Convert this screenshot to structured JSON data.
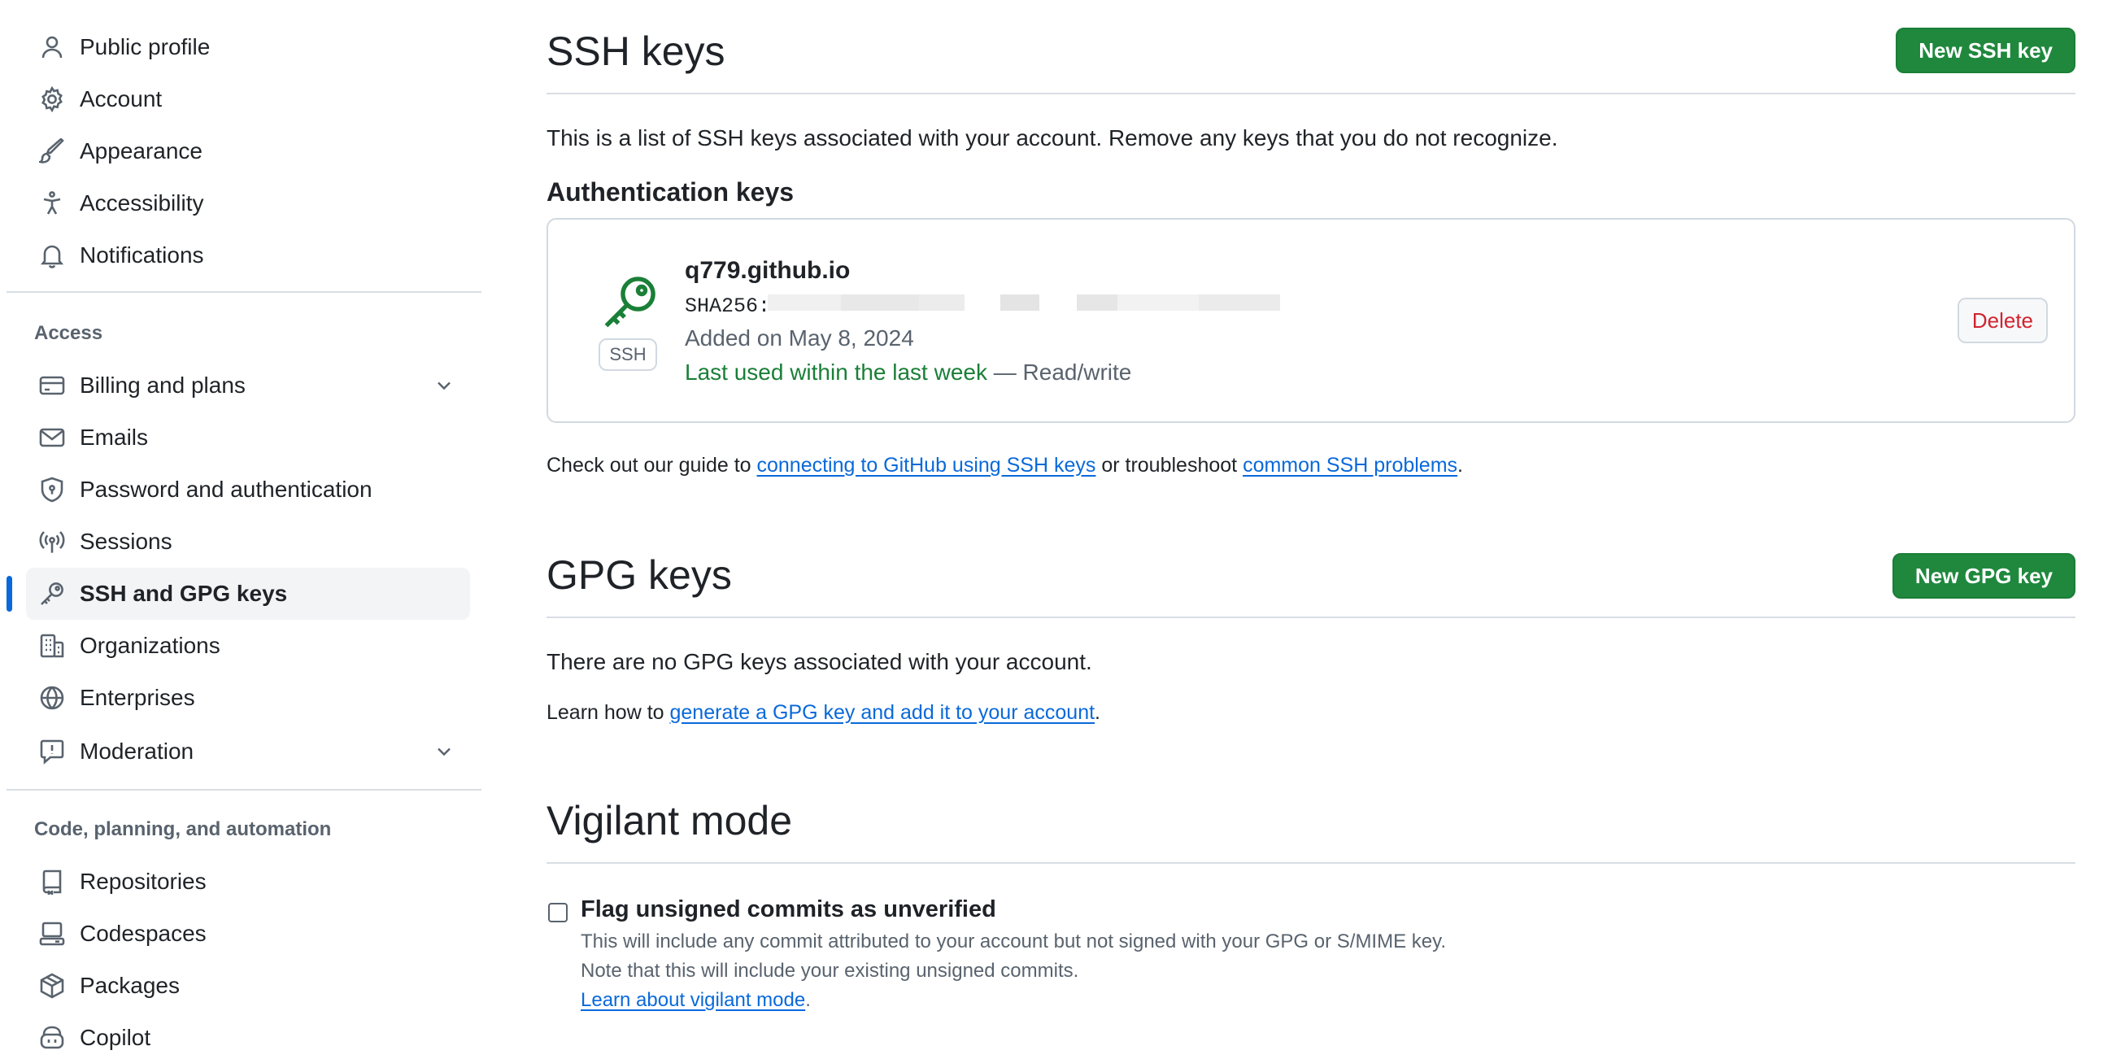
{
  "sidebar": {
    "top_items": [
      {
        "label": "Public profile",
        "icon": "person-icon"
      },
      {
        "label": "Account",
        "icon": "gear-icon"
      },
      {
        "label": "Appearance",
        "icon": "paintbrush-icon"
      },
      {
        "label": "Accessibility",
        "icon": "accessibility-icon"
      },
      {
        "label": "Notifications",
        "icon": "bell-icon"
      }
    ],
    "access_heading": "Access",
    "access_items": [
      {
        "label": "Billing and plans",
        "icon": "credit-card-icon",
        "expandable": true
      },
      {
        "label": "Emails",
        "icon": "mail-icon"
      },
      {
        "label": "Password and authentication",
        "icon": "shield-lock-icon"
      },
      {
        "label": "Sessions",
        "icon": "broadcast-icon"
      },
      {
        "label": "SSH and GPG keys",
        "icon": "key-icon",
        "active": true
      },
      {
        "label": "Organizations",
        "icon": "organization-icon"
      },
      {
        "label": "Enterprises",
        "icon": "globe-icon"
      },
      {
        "label": "Moderation",
        "icon": "report-icon",
        "expandable": true
      }
    ],
    "code_heading": "Code, planning, and automation",
    "code_items": [
      {
        "label": "Repositories",
        "icon": "repo-icon"
      },
      {
        "label": "Codespaces",
        "icon": "codespaces-icon"
      },
      {
        "label": "Packages",
        "icon": "package-icon"
      },
      {
        "label": "Copilot",
        "icon": "copilot-icon"
      }
    ]
  },
  "ssh": {
    "title": "SSH keys",
    "new_button": "New SSH key",
    "description": "This is a list of SSH keys associated with your account. Remove any keys that you do not recognize.",
    "auth_heading": "Authentication keys",
    "key": {
      "badge": "SSH",
      "title": "q779.github.io",
      "fingerprint_prefix": "SHA256:",
      "added": "Added on May 8, 2024",
      "last_used": "Last used within the last week",
      "access": " — Read/write",
      "delete_button": "Delete"
    },
    "guide_prefix": "Check out our guide to ",
    "guide_link1": "connecting to GitHub using SSH keys",
    "guide_middle": " or troubleshoot ",
    "guide_link2": "common SSH problems",
    "guide_suffix": "."
  },
  "gpg": {
    "title": "GPG keys",
    "new_button": "New GPG key",
    "empty": "There are no GPG keys associated with your account.",
    "learn_prefix": "Learn how to ",
    "learn_link": "generate a GPG key and add it to your account",
    "learn_suffix": "."
  },
  "vigilant": {
    "title": "Vigilant mode",
    "checkbox_label": "Flag unsigned commits as unverified",
    "desc1": "This will include any commit attributed to your account but not signed with your GPG or S/MIME key.",
    "desc2": "Note that this will include your existing unsigned commits.",
    "learn_link": "Learn about vigilant mode",
    "learn_suffix": "."
  },
  "colors": {
    "primary_green": "#1f883d",
    "link_blue": "#0969da",
    "danger_red": "#d1242f",
    "active_indicator": "#0969da"
  }
}
